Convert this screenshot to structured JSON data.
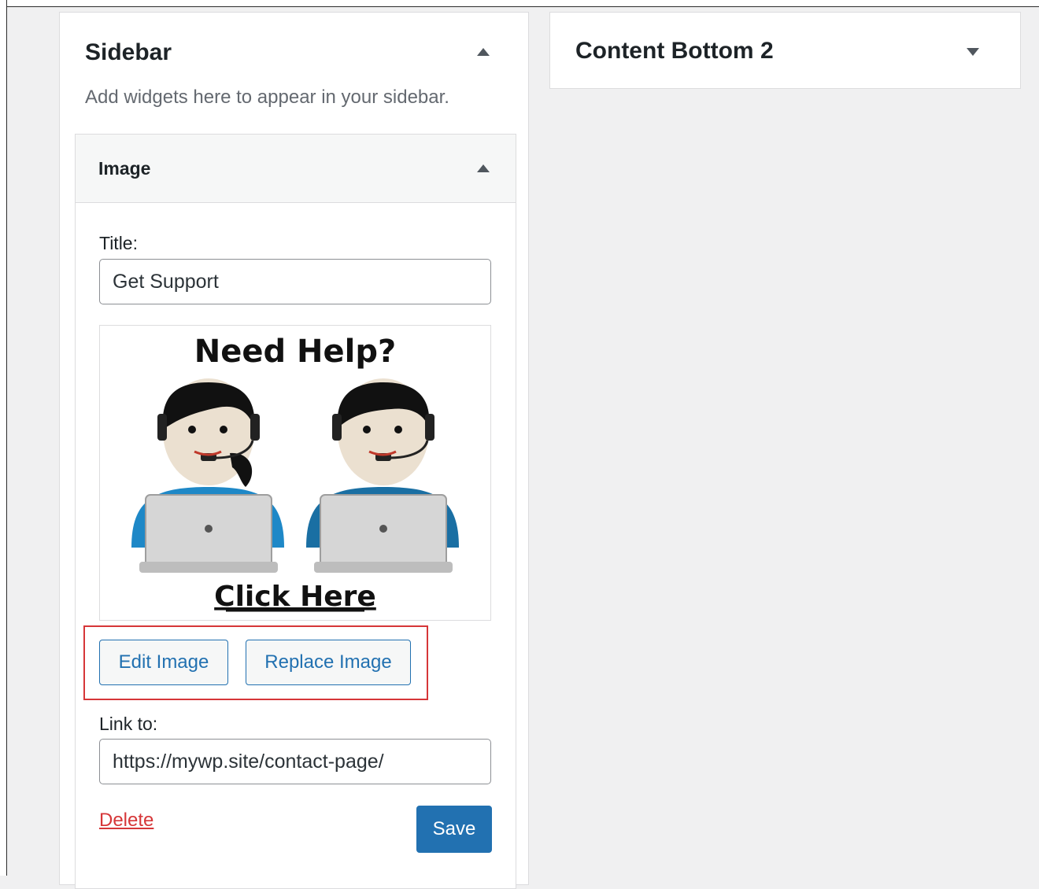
{
  "sidebar_area": {
    "title": "Sidebar",
    "description": "Add widgets here to appear in your sidebar.",
    "toggle_icon": "arrow-up-icon"
  },
  "image_widget": {
    "title": "Image",
    "toggle_icon": "arrow-up-icon",
    "title_label": "Title:",
    "title_value": "Get Support",
    "preview_heading": "Need Help?",
    "preview_footer": "Click Here",
    "edit_image_label": "Edit Image",
    "replace_image_label": "Replace Image",
    "link_label": "Link to:",
    "link_value": "https://mywp.site/contact-page/",
    "delete_label": "Delete",
    "save_label": "Save"
  },
  "content_bottom_area": {
    "title": "Content Bottom 2",
    "toggle_icon": "arrow-down-icon"
  },
  "colors": {
    "accent": "#2271b1",
    "danger": "#d63638",
    "background": "#f0f0f1"
  }
}
